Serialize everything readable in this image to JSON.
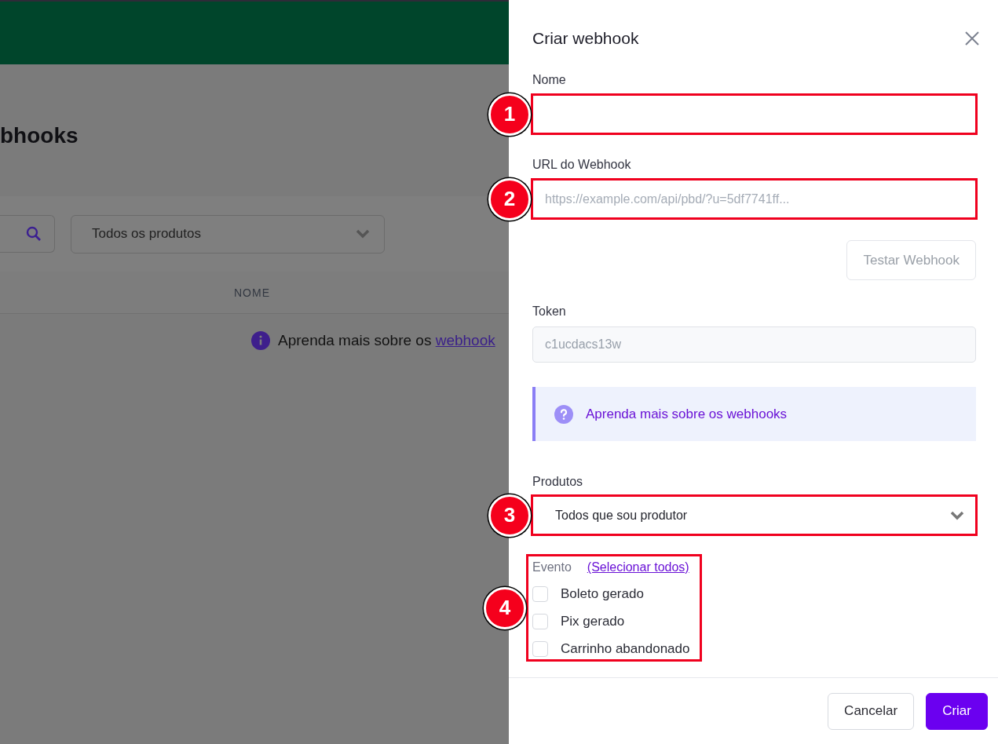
{
  "background": {
    "page_title": "bhooks",
    "product_filter": "Todos os produtos",
    "table_columns": [
      "NOME"
    ],
    "info": {
      "text": "Aprenda mais sobre os ",
      "link": "webhook"
    }
  },
  "drawer": {
    "title": "Criar webhook",
    "fields": [
      {
        "kind": "input",
        "label": "Nome",
        "marker": "1"
      },
      {
        "kind": "input",
        "label": "URL do Webhook",
        "placeholder": "https://example.com/api/pbd/?u=5df7741ff...",
        "marker": "2"
      },
      {
        "kind": "button",
        "label": "Testar Webhook",
        "disabled": true
      },
      {
        "kind": "input",
        "label": "Token",
        "value": "c1ucdacs13w",
        "disabled": true
      },
      {
        "kind": "callout",
        "text": "Aprenda mais sobre os webhooks"
      },
      {
        "kind": "select",
        "label": "Produtos",
        "value": "Todos que sou produtor",
        "marker": "3"
      },
      {
        "kind": "checklist",
        "label": "Evento",
        "link": "(Selecionar todos)",
        "marker": "4",
        "options": [
          {
            "label": "Boleto gerado",
            "checked": false
          },
          {
            "label": "Pix gerado",
            "checked": false
          },
          {
            "label": "Carrinho abandonado",
            "checked": false
          }
        ]
      }
    ],
    "buttons": [
      {
        "label": "Cancelar",
        "primary": false
      },
      {
        "label": "Criar",
        "primary": true
      }
    ]
  }
}
